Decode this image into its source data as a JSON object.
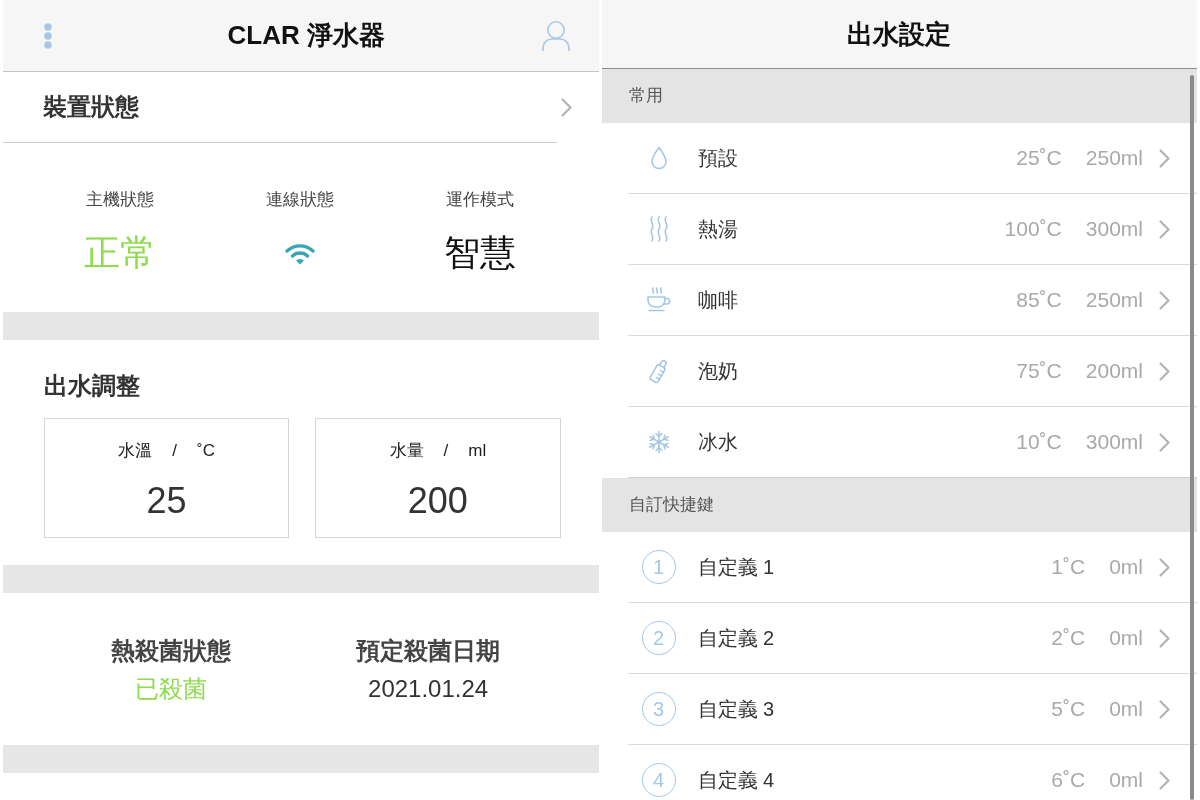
{
  "left_screen": {
    "header": {
      "title": "CLAR 淨水器"
    },
    "device_status": {
      "title": "裝置狀態",
      "items": [
        {
          "kind": "text",
          "label": "主機狀態",
          "value": "正常",
          "color": "#8edb50"
        },
        {
          "kind": "wifi",
          "label": "連線狀態",
          "color": "#3aa5b3"
        },
        {
          "kind": "text",
          "label": "運作模式",
          "value": "智慧",
          "color": "#111111"
        }
      ]
    },
    "water_adjustment": {
      "title": "出水調整",
      "fields": [
        {
          "label": "水溫",
          "separator": "/",
          "unit": "˚C",
          "value": "25"
        },
        {
          "label": "水量",
          "separator": "/",
          "unit": "ml",
          "value": "200"
        }
      ]
    },
    "sterilization": {
      "items": [
        {
          "label": "熱殺菌狀態",
          "value": "已殺菌",
          "color": "#8edb50"
        },
        {
          "label": "預定殺菌日期",
          "value": "2021.01.24",
          "color": "#333333"
        }
      ]
    }
  },
  "right_screen": {
    "header": {
      "title": "出水設定"
    },
    "sections": [
      {
        "title": "常用",
        "rows": [
          {
            "kind": "drop",
            "label": "預設",
            "temperature": "25˚C",
            "volume": "250ml"
          },
          {
            "kind": "steam",
            "label": "熱湯",
            "temperature": "100˚C",
            "volume": "300ml"
          },
          {
            "kind": "cup",
            "label": "咖啡",
            "temperature": "85˚C",
            "volume": "250ml"
          },
          {
            "kind": "bottle",
            "label": "泡奶",
            "temperature": "75˚C",
            "volume": "200ml"
          },
          {
            "kind": "snowflake",
            "label": "冰水",
            "temperature": "10˚C",
            "volume": "300ml"
          }
        ]
      },
      {
        "title": "自訂快捷鍵",
        "rows": [
          {
            "kind": "number",
            "number": "1",
            "label": "自定義 1",
            "temperature": "1˚C",
            "volume": "0ml"
          },
          {
            "kind": "number",
            "number": "2",
            "label": "自定義 2",
            "temperature": "2˚C",
            "volume": "0ml"
          },
          {
            "kind": "number",
            "number": "3",
            "label": "自定義 3",
            "temperature": "5˚C",
            "volume": "0ml"
          },
          {
            "kind": "number",
            "number": "4",
            "label": "自定義 4",
            "temperature": "6˚C",
            "volume": "0ml"
          }
        ]
      }
    ]
  }
}
